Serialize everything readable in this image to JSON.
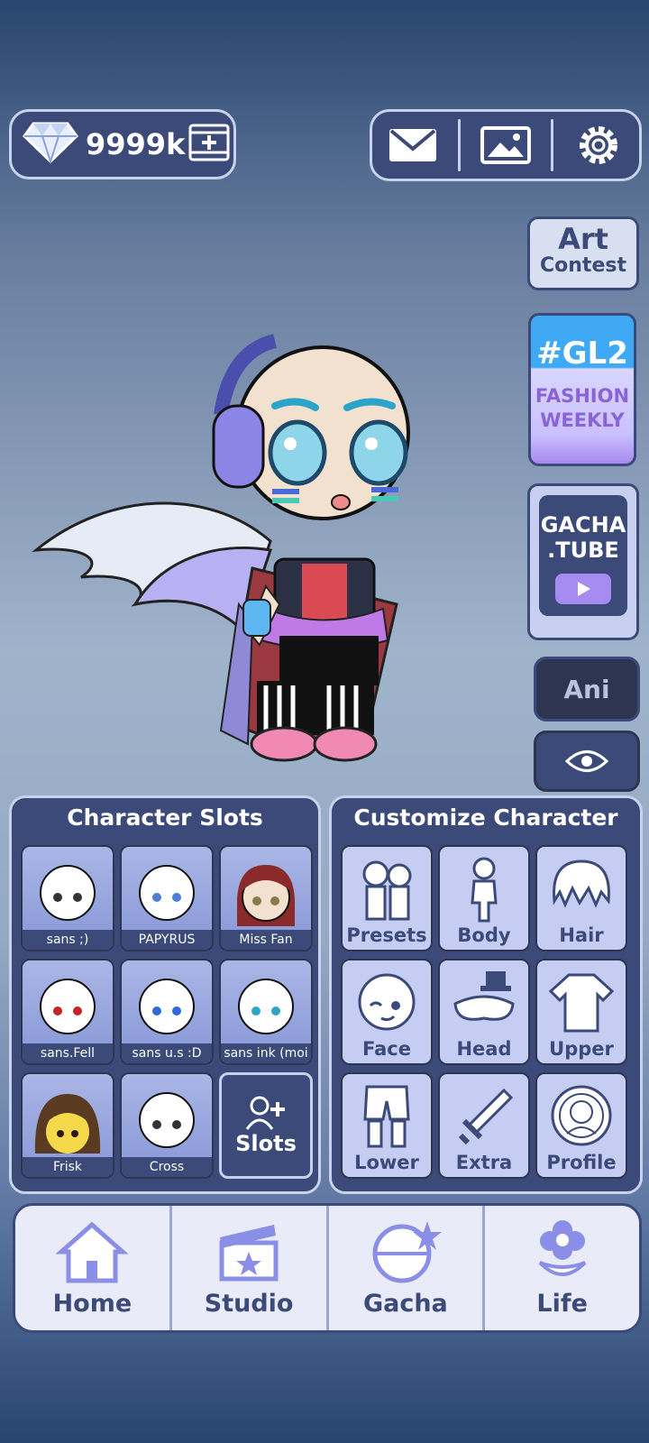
{
  "currency": {
    "amount": "9999k"
  },
  "side": {
    "art_line1": "Art",
    "art_line2": "Contest",
    "gl2_line1": "#GL2",
    "gl2_line2": "FASHION",
    "gl2_line3": "WEEKLY",
    "tube_line1": "GACHA",
    "tube_line2": ".TUBE",
    "ani": "Ani"
  },
  "slots": {
    "title": "Character Slots",
    "items": [
      {
        "label": "sans ;)",
        "eye": "#333333"
      },
      {
        "label": "PAPYRUS",
        "eye": "#4d7fd6"
      },
      {
        "label": "Miss Fan",
        "eye": "#8a7a4a"
      },
      {
        "label": "sans.Fell",
        "eye": "#c42424"
      },
      {
        "label": "sans u.s :D",
        "eye": "#2f6bd6"
      },
      {
        "label": "sans ink (moi",
        "eye": "#2fa4c9"
      },
      {
        "label": "Frisk",
        "eye": "#2a1a10"
      },
      {
        "label": "Cross",
        "eye": "#333333"
      }
    ],
    "add_label": "Slots"
  },
  "customize": {
    "title": "Customize Character",
    "items": [
      "Presets",
      "Body",
      "Hair",
      "Face",
      "Head",
      "Upper",
      "Lower",
      "Extra",
      "Profile"
    ]
  },
  "nav": {
    "items": [
      "Home",
      "Studio",
      "Gacha",
      "Life"
    ]
  },
  "colors": {
    "panel": "#3b4a78",
    "accent": "#a68cf0",
    "cell": "#c6cdf2"
  }
}
